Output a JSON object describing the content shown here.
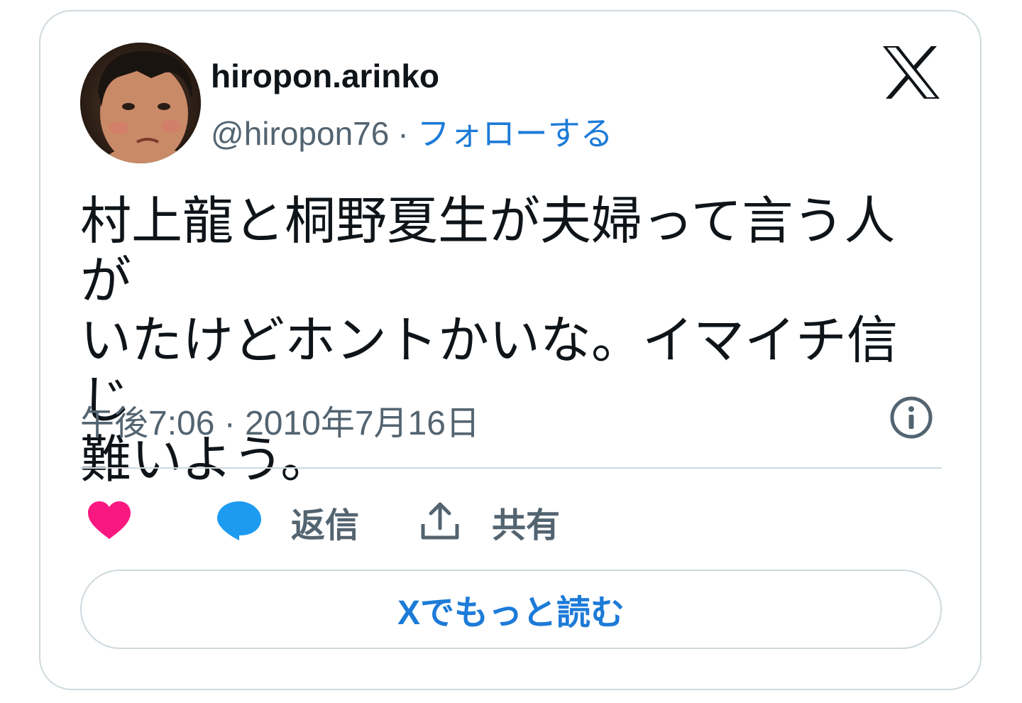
{
  "author": {
    "display_name": "hiropon.arinko",
    "handle": "@hiropon76",
    "separator": "·",
    "follow_label": "フォローする"
  },
  "tweet": {
    "text": "村上龍と桐野夏生が夫婦って言う人が\nいたけどホントかいな。イマイチ信じ\n難いよう。",
    "timestamp": "午後7:06 · 2010年7月16日"
  },
  "actions": {
    "reply_label": "返信",
    "share_label": "共有"
  },
  "read_more_label": "Xでもっと読む",
  "icons": [
    "x-logo-icon",
    "info-icon",
    "heart-icon",
    "reply-bubble-icon",
    "share-icon"
  ],
  "colors": {
    "accent": "#1d7bd8",
    "heart": "#f91880",
    "reply": "#1d9bf0",
    "secondary_text": "#536471",
    "border": "#cfd9de"
  }
}
